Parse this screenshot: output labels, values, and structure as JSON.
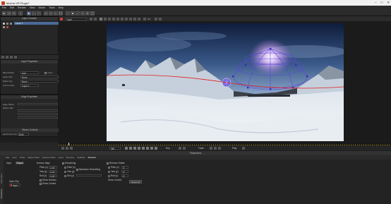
{
  "window": {
    "title": "Mocha VR Plugin*"
  },
  "menu": [
    "File",
    "Edit",
    "Render",
    "View",
    "Movie",
    "Tools",
    "Help"
  ],
  "layer_controls": {
    "header": "Layer Controls",
    "layer_name": "Layer 1"
  },
  "layer_properties": {
    "header": "Layer Properties",
    "blend_mode_label": "Blend Mode",
    "blend_mode_value": "Add",
    "invert_label": "Invert",
    "insert_clip_label": "Insert Clip",
    "insert_clip_value": "None",
    "matte_clip_label": "Matte Clip",
    "matte_clip_value": "None",
    "link_to_track_label": "Link to track",
    "link_to_track_value": "Layer 1"
  },
  "edge_properties": {
    "header": "Edge Properties",
    "edge_width_label": "Edge Width",
    "motion_blur_label": "Motion Blur"
  },
  "stereo_controls": {
    "header": "Stereo Controls",
    "view_label": "Eye/Frame Op",
    "view_value": "Both"
  },
  "viewer": {
    "clip_name": "Input",
    "zoom": "0.5",
    "overlay_colors": {
      "mesh": "#5a4ad8",
      "spline": "#e02020",
      "glow": "#d8b0ff"
    }
  },
  "transport": {
    "frame_current": "360",
    "key_label": "Key",
    "track_label": "Track",
    "play_label": "Play"
  },
  "parameters": {
    "header": "Parameters",
    "side_tabs": [
      "Parameters",
      "Dope Sheet"
    ],
    "tabs": [
      "Clip",
      "Lens",
      "Track",
      "Adjust Track",
      "Camera Solve",
      "Insert",
      "Remove",
      "Stabilize",
      "Reorient"
    ],
    "active_tab": "Reorient",
    "input_label": "Input",
    "output_label": "Output",
    "input_clip_label": "Input Clip",
    "input_clip_value": "Input",
    "horizon_align_label": "Horizon Align",
    "pitch_label": "Pitch (x)",
    "pitch_value": "0.00°",
    "yaw_label": "Yaw (y)",
    "yaw_value": "0.00°",
    "roll_label": "Roll (z)",
    "roll_value": "0.00°",
    "smoothing_label": "Smoothing",
    "smooth_pitch": "Pitch (x)",
    "smooth_yaw": "Yaw (y)",
    "smooth_roll": "Roll (z)",
    "max_smoothing_label": "Maximum Smoothing",
    "show_horizon": "Show Horizon",
    "show_control": "Show Control",
    "remove_shake_label": "Remove Shake",
    "shake_pitch": "Pitch (x)",
    "shake_yaw": "Yaw (y)",
    "shake_roll": "Roll (z)",
    "shake_pitch_value": "0°",
    "shake_yaw_value": "0°",
    "shake_roll_value": "0°",
    "reset_label": "Reset All"
  }
}
